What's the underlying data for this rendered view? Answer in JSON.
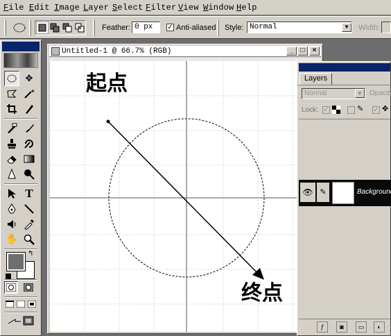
{
  "menu": [
    "File",
    "Edit",
    "Image",
    "Layer",
    "Select",
    "Filter",
    "View",
    "Window",
    "Help"
  ],
  "options": {
    "feather_label": "Feather:",
    "feather_value": "0 px",
    "antialiased_label": "Anti-aliased",
    "antialiased_checked": "✓",
    "style_label": "Style:",
    "style_value": "Normal",
    "width_label": "Width:"
  },
  "document": {
    "title": "Untitled-1 @ 66.7% (RGB)",
    "start_label": "起点",
    "end_label": "终点"
  },
  "layers": {
    "tab": "Layers",
    "blend_mode": "Normal",
    "opacity_label": "Opacity",
    "lock_label": "Lock:",
    "layer_name": "Background"
  },
  "colors": {
    "foreground": "#6e6e6e",
    "background": "#ffffff",
    "title_active": "#0a246a",
    "face": "#d4d0c8"
  },
  "icons": {
    "tools": [
      "elliptical-marquee",
      "move",
      "lasso",
      "magic-wand",
      "crop",
      "slice",
      "healing-brush",
      "brush",
      "clone-stamp",
      "history-brush",
      "eraser",
      "gradient",
      "blur",
      "dodge",
      "path-selection",
      "type",
      "pen",
      "line",
      "notes",
      "eyedropper",
      "hand",
      "zoom"
    ]
  }
}
